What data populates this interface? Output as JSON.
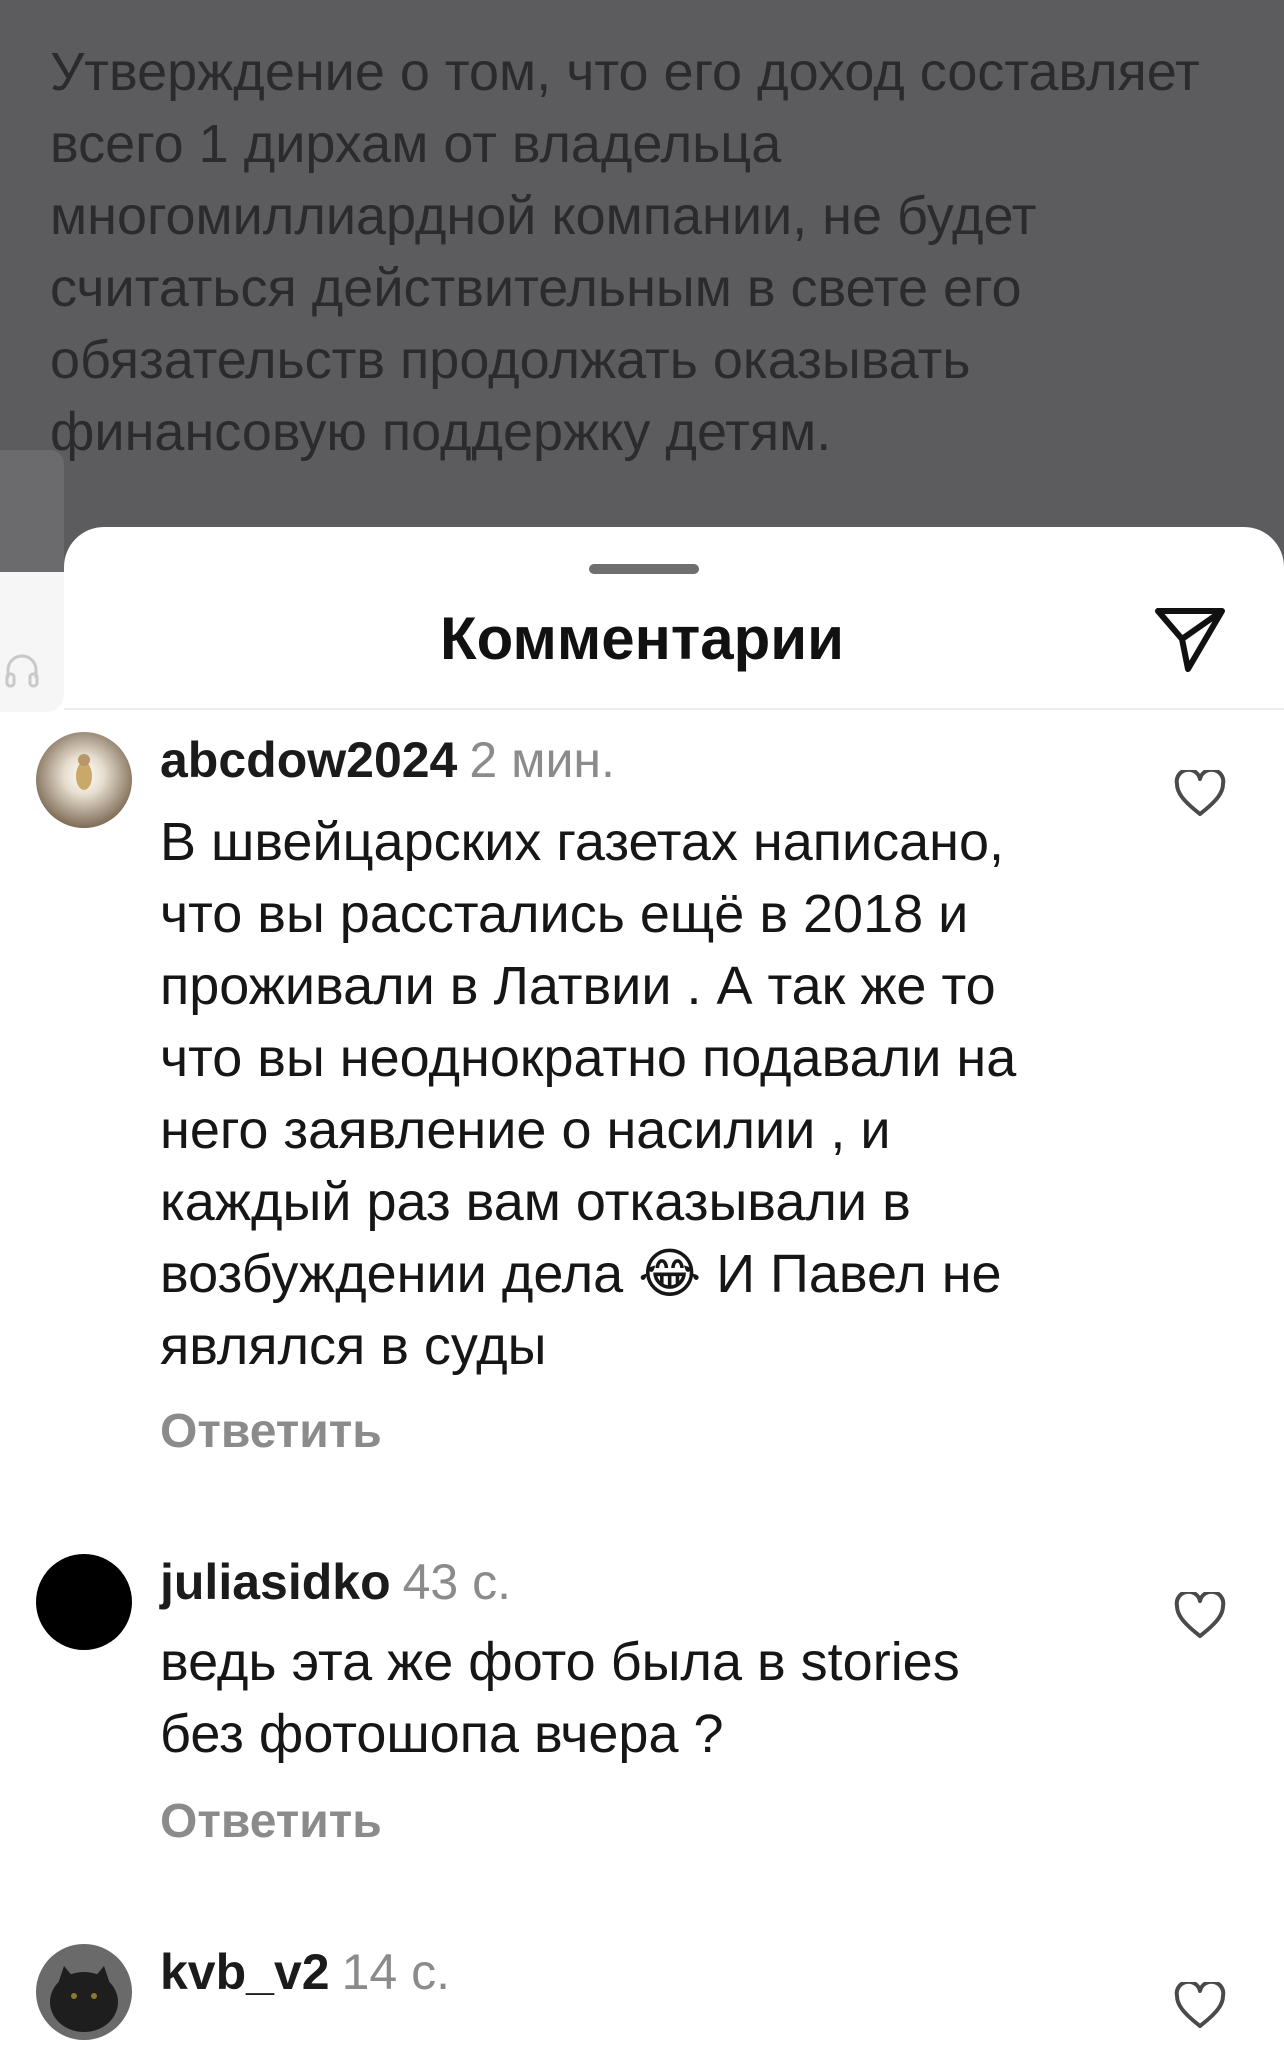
{
  "backdrop": {
    "text": "Утверждение о том, что его доход составляет всего 1 дирхам от владельца многомиллиардной компании, не будет считаться действительным в свете его обязательств продолжать оказывать финансовую поддержку детям."
  },
  "sheet": {
    "title": "Комментарии",
    "share_icon": "paper-plane-icon"
  },
  "comments": [
    {
      "username": "abcdow2024",
      "time": "2 мин.",
      "text": "В швейцарских газетах написано,\nчто вы расстались ещё в 2018 и\nпроживали в Латвии . А так же то\nчто вы неоднократно подавали на\nнего заявление о насилии , и\nкаждый раз вам отказывали в\nвозбуждении дела 😂 И Павел не\nявлялся в суды",
      "reply_label": "Ответить",
      "avatar_color": "#a08f7a"
    },
    {
      "username": "juliasidko",
      "time": "43 с.",
      "text": "ведь эта же фото была в stories\nбез фотошопа вчера ?",
      "reply_label": "Ответить",
      "avatar_color": "#000000"
    },
    {
      "username": "kvb_v2",
      "time": "14 с.",
      "text": "",
      "reply_label": "",
      "avatar_color": "#2a2a2a"
    }
  ]
}
